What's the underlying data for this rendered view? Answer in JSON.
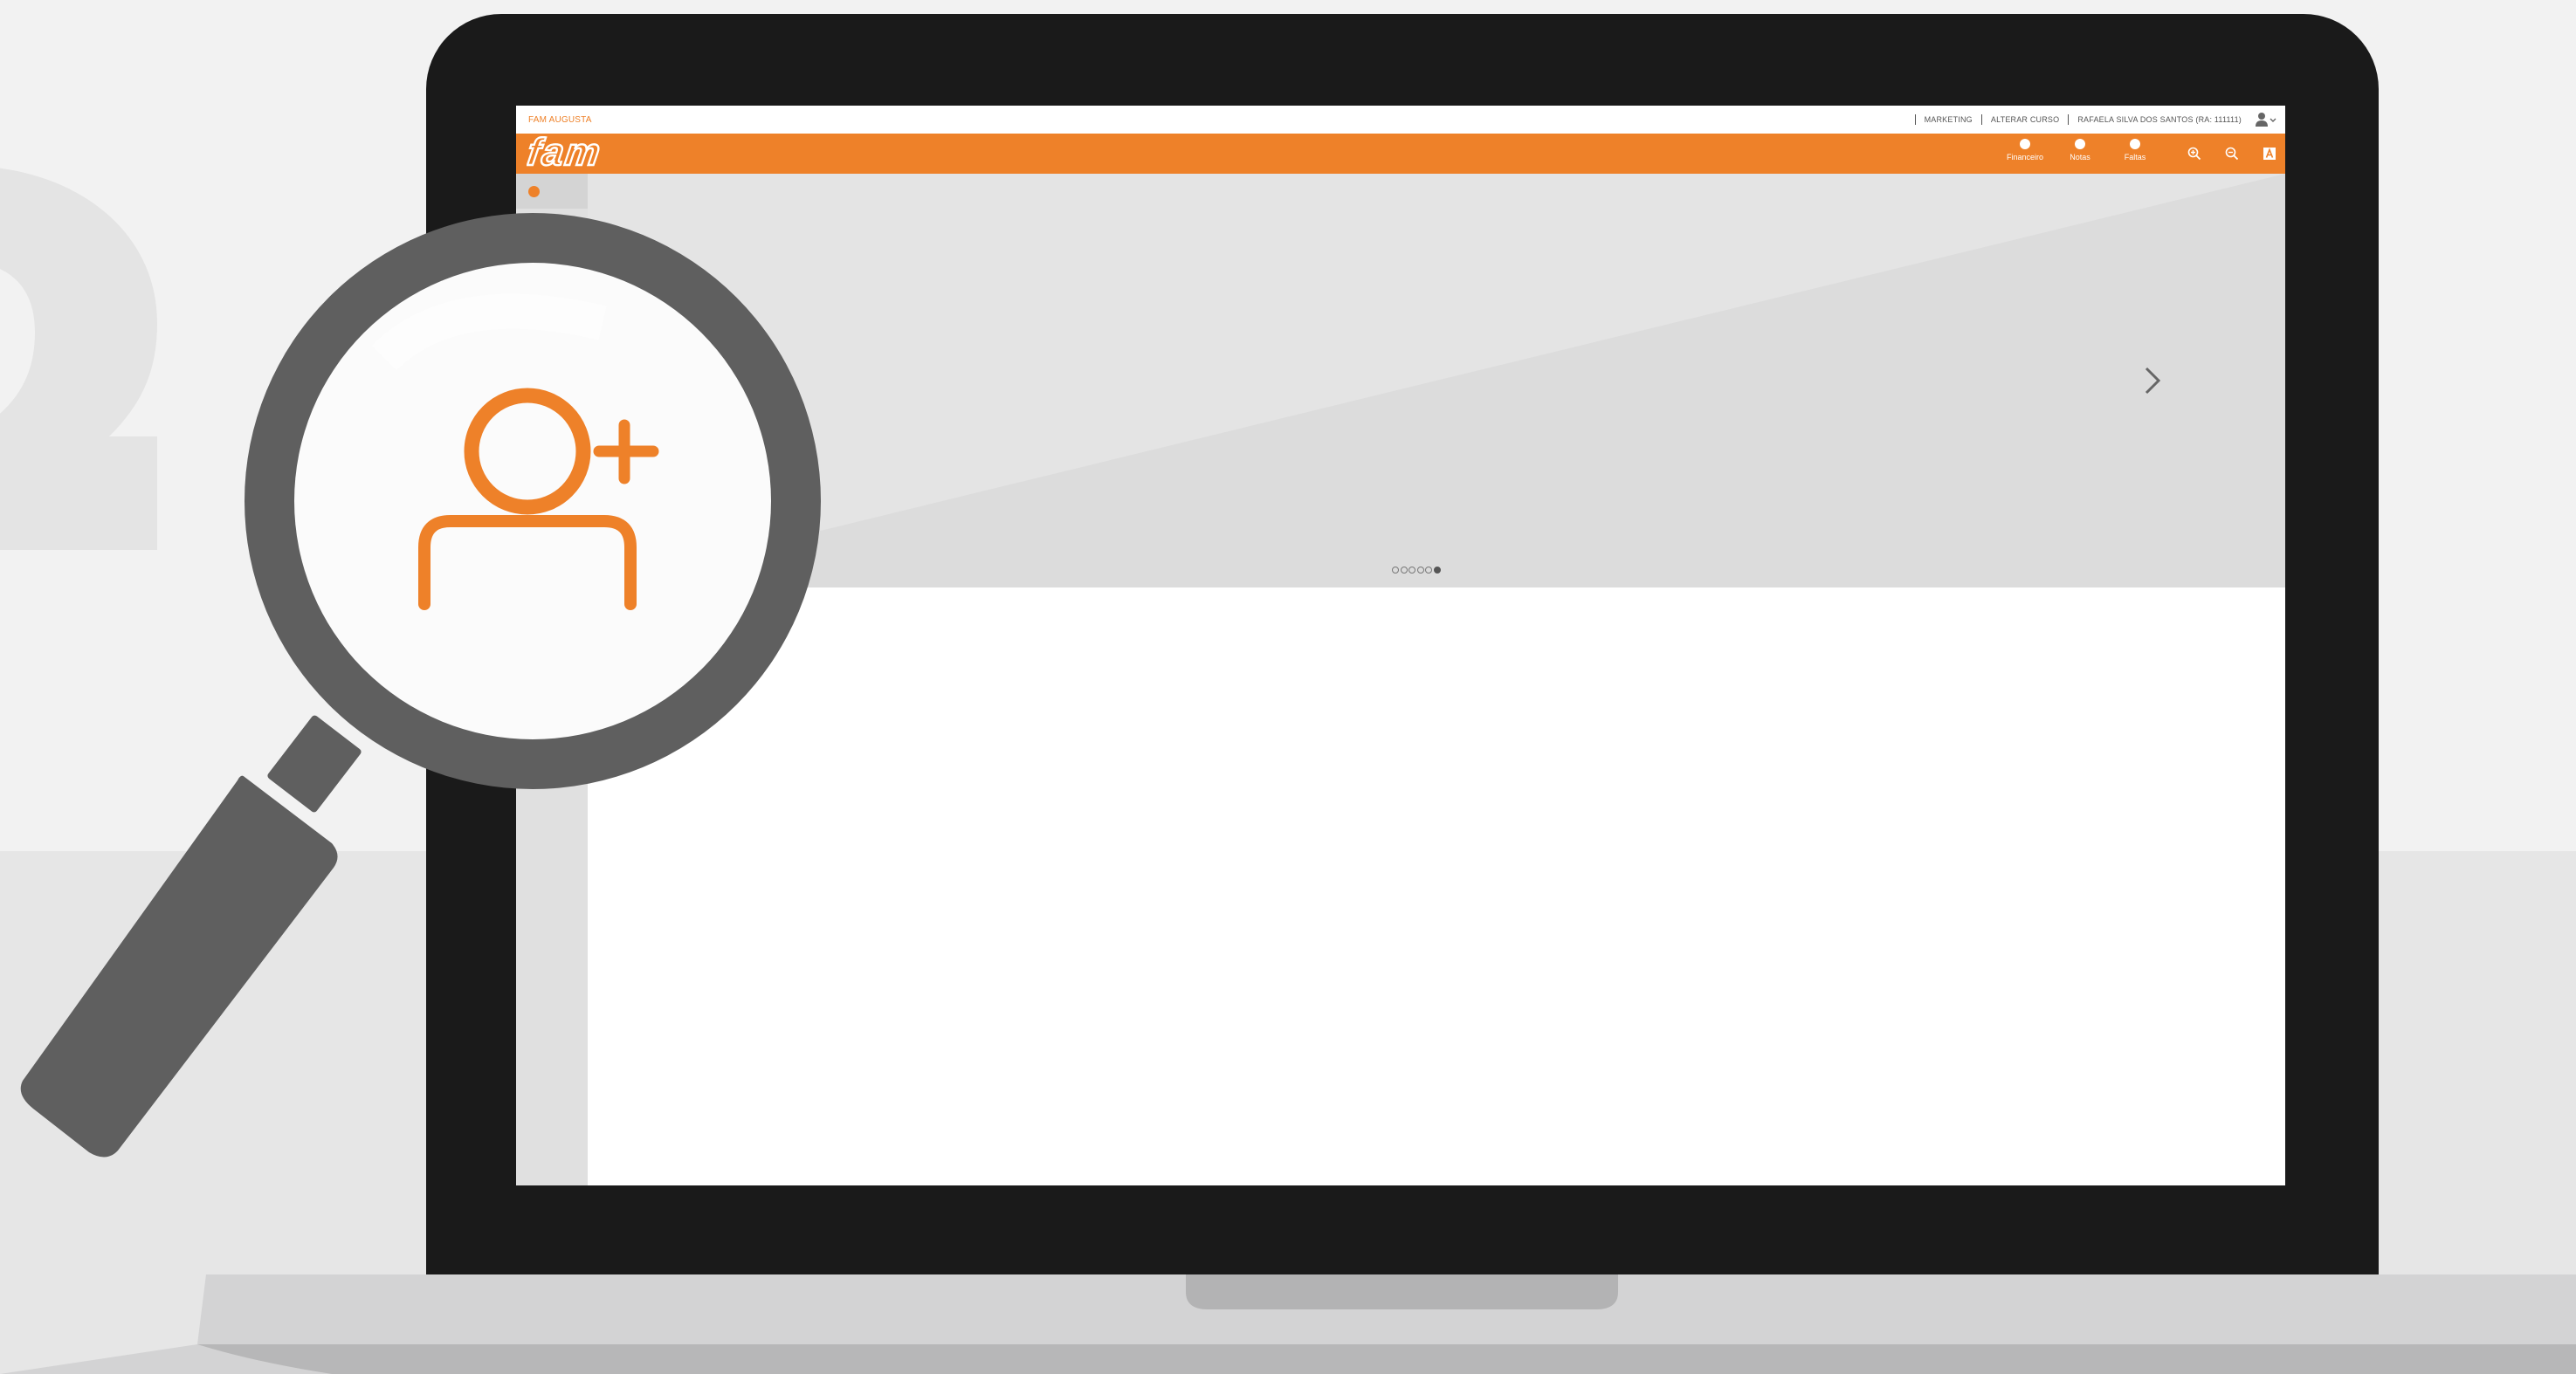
{
  "topbar": {
    "campus": "FAM AUGUSTA",
    "links": [
      "MARKETING",
      "ALTERAR CURSO",
      "RAFAELA SILVA DOS SANTOS (RA: 111111)"
    ]
  },
  "navbar": {
    "logo_text": "fam",
    "items": [
      "Financeiro",
      "Notas",
      "Faltas"
    ]
  },
  "banner": {
    "slides": 6,
    "active_slide": 6
  },
  "colors": {
    "accent": "#ee8129",
    "bezel": "#1a1a1a",
    "magnifier": "#5f5f5f",
    "background": "#f2f2f2"
  },
  "icons": {
    "center_icon": "add-user-icon",
    "toolbar": [
      "zoom-in-icon",
      "zoom-out-icon",
      "accessibility-icon"
    ]
  }
}
